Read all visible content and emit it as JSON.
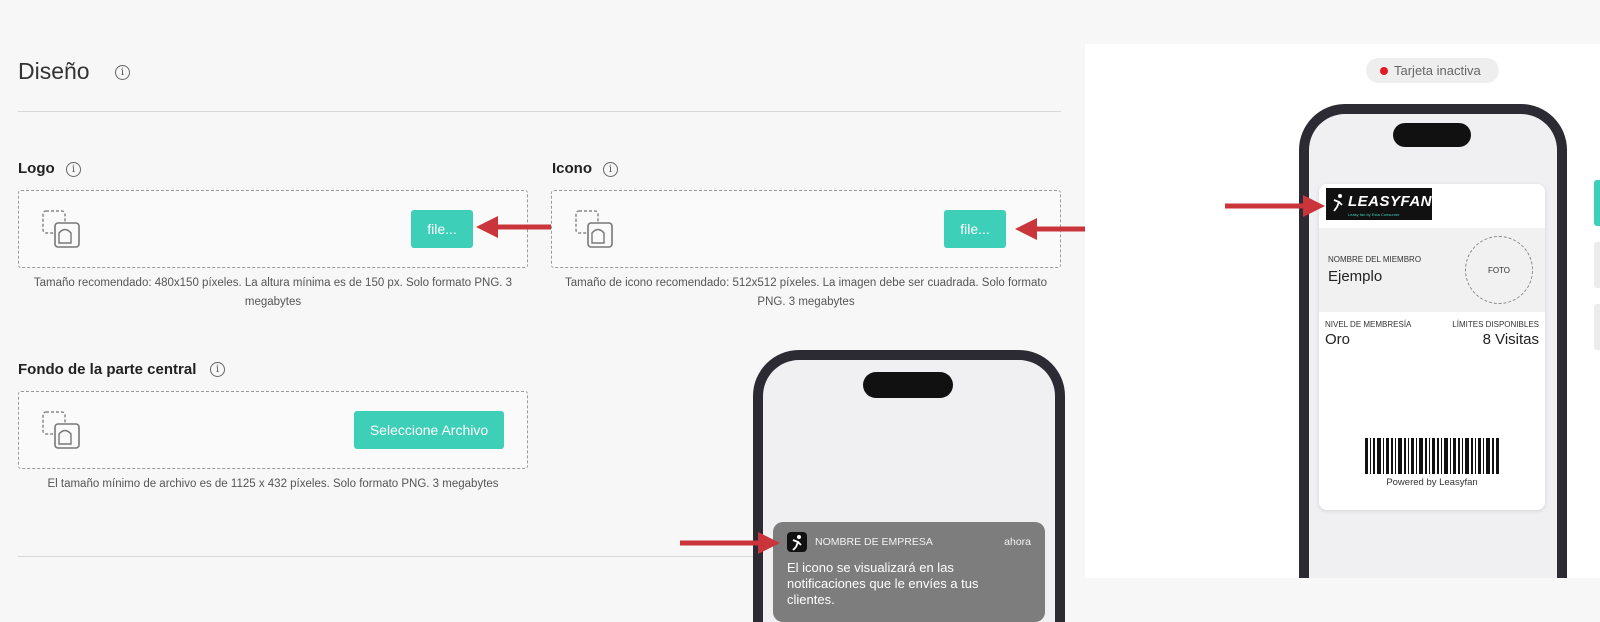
{
  "section": {
    "title": "Diseño",
    "info_glyph": "i"
  },
  "logo": {
    "label": "Logo",
    "button": "file...",
    "hint": "Tamaño recomendado: 480x150 píxeles. La altura mínima es de 150 px. Solo formato PNG. 3 megabytes"
  },
  "icono": {
    "label": "Icono",
    "button": "file...",
    "hint": "Tamaño de icono recomendado: 512x512 píxeles. La imagen debe ser cuadrada. Solo formato PNG. 3 megabytes"
  },
  "fondo": {
    "label": "Fondo de la parte central",
    "button": "Seleccione Archivo",
    "hint": "El tamaño mínimo de archivo es de 1125 x 432 píxeles. Solo formato PNG. 3 megabytes"
  },
  "notification": {
    "company": "NOMBRE DE EMPRESA",
    "time": "ahora",
    "message": "El icono se visualizará en las notificaciones que le envíes a tus clientes."
  },
  "preview": {
    "status": "Tarjeta inactiva",
    "status_color": "#e01b24",
    "logo_text": "LEASYFAN",
    "logo_tagline": "Leasy fan by Esta Consumer",
    "member_label": "NOMBRE DEL MIEMBRO",
    "member_value": "Ejemplo",
    "photo_label": "FOTO",
    "level_label": "NIVEL DE MEMBRESÍA",
    "level_value": "Oro",
    "limits_label": "LÍMITES DISPONIBLES",
    "limits_value": "8 Visitas",
    "powered": "Powered by Leasyfan"
  },
  "colors": {
    "accent": "#3ecfb8",
    "arrow": "#c9353a"
  }
}
